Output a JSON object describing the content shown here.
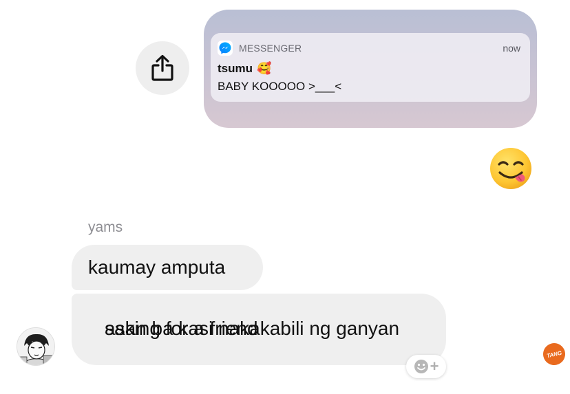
{
  "shared_notification": {
    "app_name": "MESSENGER",
    "time": "now",
    "title": "tsumu",
    "title_emoji": "🥰",
    "body": "BABY KOOOOO >___<",
    "app_icon": "messenger-icon"
  },
  "share_button": {
    "icon": "share-icon"
  },
  "emoji_message": {
    "icon": "face-savoring-food-emoji"
  },
  "conversation": {
    "sender_name": "yams",
    "messages": [
      {
        "text": "kaumay amputa"
      },
      {
        "line1": "saan ba kasi nakakabili ng ganyan",
        "line2": "asking for a friend"
      }
    ]
  },
  "reaction_button": {
    "icon": "add-reaction-icon",
    "plus": "+"
  },
  "watermark": {
    "text": "TANG"
  },
  "colors": {
    "bubble_bg": "#efefef",
    "share_button_bg": "#eeeeee",
    "sender_name": "#8e8e93",
    "messenger_blue": "#0a7cff"
  }
}
